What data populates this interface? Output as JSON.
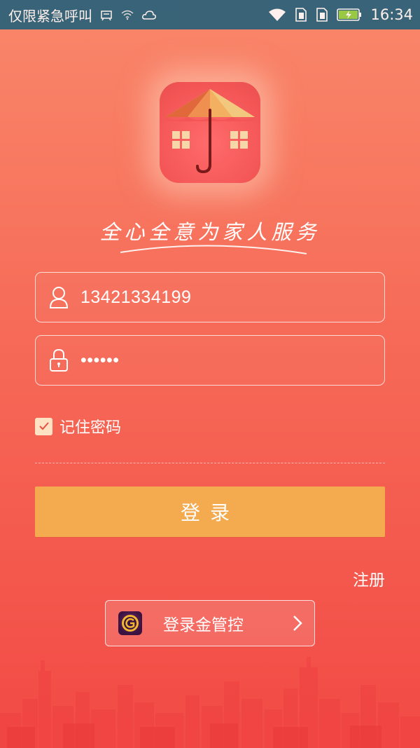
{
  "status_bar": {
    "carrier": "仅限紧急呼叫",
    "time": "16:34"
  },
  "app": {
    "slogan": "全心全意为家人服务"
  },
  "form": {
    "phone_value": "13421334199",
    "password_value": "••••••",
    "remember_label": "记住密码",
    "remember_checked": true,
    "login_label": "登录",
    "register_label": "注册",
    "alt_login_label": "登录金管控"
  },
  "colors": {
    "primary_button": "#f4aa4f",
    "background_top": "#f9876a",
    "background_bottom": "#f24a45"
  }
}
